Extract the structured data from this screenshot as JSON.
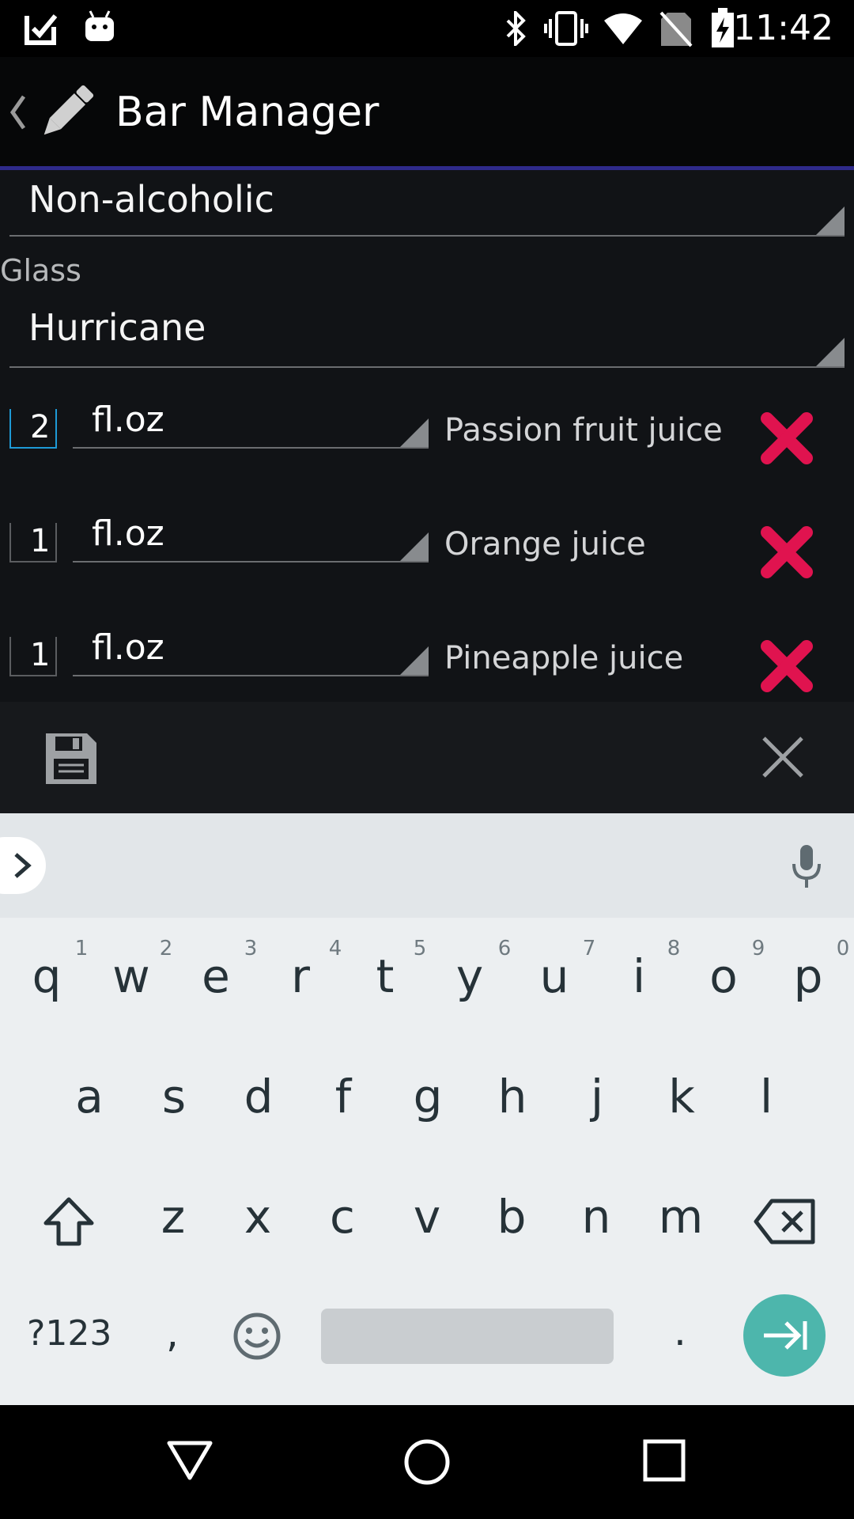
{
  "status_bar": {
    "time": "11:42"
  },
  "action_bar": {
    "title": "Bar Manager"
  },
  "form": {
    "category_value": "Non-alcoholic",
    "glass_label": "Glass",
    "glass_value": "Hurricane",
    "ingredients": [
      {
        "qty": "2",
        "unit": "fl.oz",
        "name": "Passion fruit juice"
      },
      {
        "qty": "1",
        "unit": "fl.oz",
        "name": "Orange juice"
      },
      {
        "qty": "1",
        "unit": "fl.oz",
        "name": "Pineapple juice"
      }
    ]
  },
  "keyboard": {
    "row1": [
      "q",
      "w",
      "e",
      "r",
      "t",
      "y",
      "u",
      "i",
      "o",
      "p"
    ],
    "row1_hints": [
      "1",
      "2",
      "3",
      "4",
      "5",
      "6",
      "7",
      "8",
      "9",
      "0"
    ],
    "row2": [
      "a",
      "s",
      "d",
      "f",
      "g",
      "h",
      "j",
      "k",
      "l"
    ],
    "row3": [
      "z",
      "x",
      "c",
      "v",
      "b",
      "n",
      "m"
    ],
    "symbols_label": "?123",
    "comma": ",",
    "period": ".",
    "enter_color": "#4db6ac"
  },
  "icons": {
    "status": [
      "check-notification-icon",
      "android-robot-icon",
      "bluetooth-icon",
      "vibrate-icon",
      "wifi-icon",
      "no-sim-icon",
      "battery-charging-icon"
    ],
    "action": [
      "back-chevron-icon",
      "pencil-icon"
    ],
    "toolbar": [
      "save-floppy-icon",
      "close-x-icon"
    ],
    "nav": [
      "back-triangle-icon",
      "home-circle-icon",
      "recents-square-icon"
    ]
  },
  "colors": {
    "accent_divider": "#2e2a8a",
    "delete_red": "#e0134f",
    "focus_blue": "#1e9ad6"
  }
}
